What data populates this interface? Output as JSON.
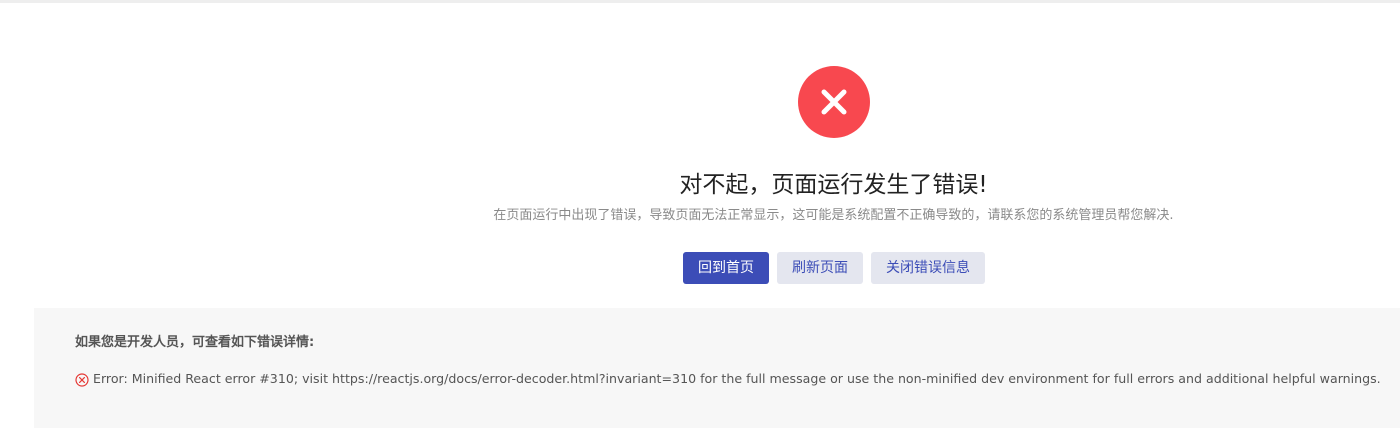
{
  "colors": {
    "error_red": "#f8484f",
    "primary_blue": "#3c4db7",
    "secondary_bg": "#e4e6ef",
    "panel_bg": "#f7f7f7"
  },
  "icons": {
    "status": "close-circle-icon",
    "error_line": "close-circle-outline-icon"
  },
  "error_page": {
    "title": "对不起，页面运行发生了错误!",
    "subtitle": "在页面运行中出现了错误，导致页面无法正常显示，这可能是系统配置不正确导致的，请联系您的系统管理员帮您解决."
  },
  "actions": {
    "home_label": "回到首页",
    "refresh_label": "刷新页面",
    "close_label": "关闭错误信息"
  },
  "details": {
    "heading": "如果您是开发人员，可查看如下错误详情:",
    "error_message": "Error: Minified React error #310; visit https://reactjs.org/docs/error-decoder.html?invariant=310 for the full message or use the non-minified dev environment for full errors and additional helpful warnings."
  }
}
